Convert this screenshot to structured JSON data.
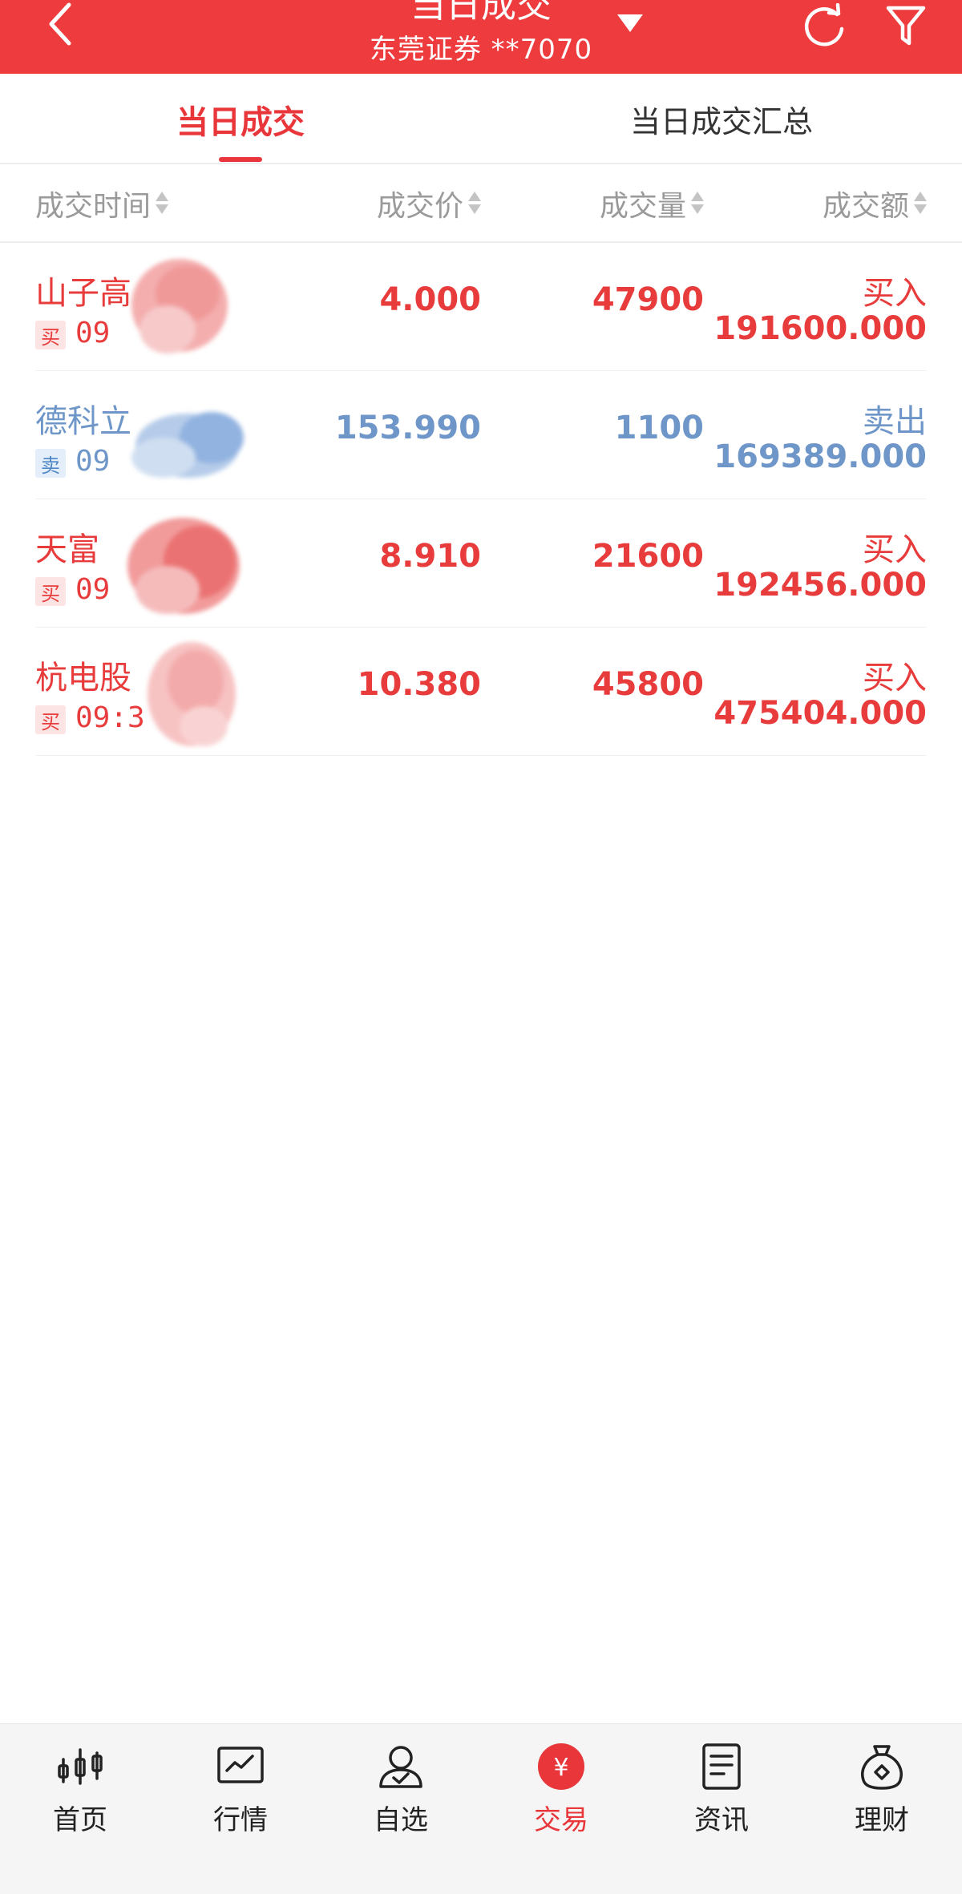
{
  "header": {
    "title": "当日成交",
    "subtitle": "东莞证券 **7070"
  },
  "tabs": [
    {
      "label": "当日成交",
      "active": true
    },
    {
      "label": "当日成交汇总",
      "active": false
    }
  ],
  "columns": {
    "time": "成交时间",
    "price": "成交价",
    "volume": "成交量",
    "amount": "成交额"
  },
  "rows": [
    {
      "name": "山子高",
      "side_tag": "买",
      "time": "09",
      "price": "4.000",
      "volume": "47900",
      "direction": "买入",
      "amount": "191600.000",
      "type": "buy"
    },
    {
      "name": "德科立",
      "side_tag": "卖",
      "time": "09",
      "price": "153.990",
      "volume": "1100",
      "direction": "卖出",
      "amount": "169389.000",
      "type": "sell"
    },
    {
      "name": "天富",
      "side_tag": "买",
      "time": "09",
      "price": "8.910",
      "volume": "21600",
      "direction": "买入",
      "amount": "192456.000",
      "type": "buy"
    },
    {
      "name": "杭电股",
      "side_tag": "买",
      "time": "09:3",
      "price": "10.380",
      "volume": "45800",
      "direction": "买入",
      "amount": "475404.000",
      "type": "buy"
    }
  ],
  "nav": [
    {
      "label": "首页",
      "icon": "candlestick-icon"
    },
    {
      "label": "行情",
      "icon": "chart-icon"
    },
    {
      "label": "自选",
      "icon": "user-check-icon"
    },
    {
      "label": "交易",
      "icon": "yuan-icon",
      "active": true
    },
    {
      "label": "资讯",
      "icon": "document-icon"
    },
    {
      "label": "理财",
      "icon": "money-bag-icon"
    }
  ],
  "colors": {
    "brand_red": "#ee3b3d",
    "buy": "#e83b3b",
    "sell": "#6e96c8"
  }
}
